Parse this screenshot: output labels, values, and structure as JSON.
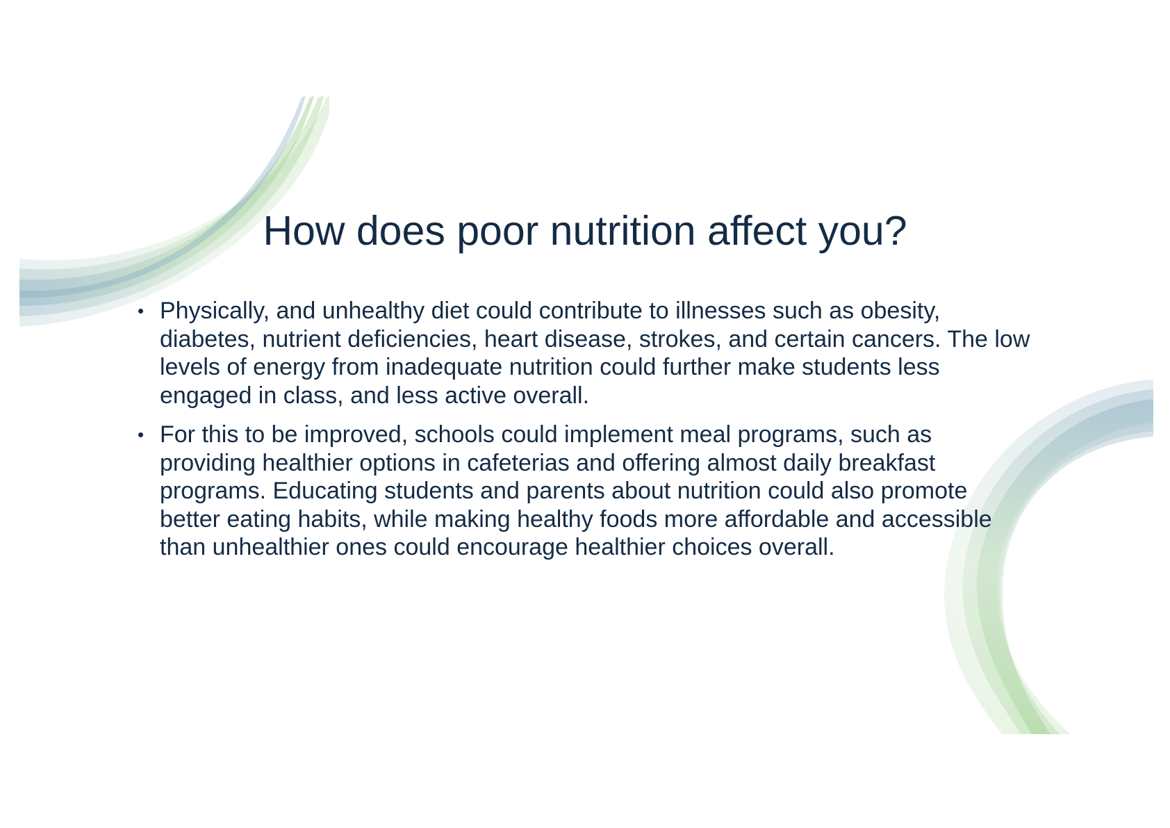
{
  "slide": {
    "title": "How does poor nutrition affect you?",
    "bullet_glyph": "•",
    "bullets": [
      "Physically, and unhealthy diet could contribute to illnesses such as obesity, diabetes, nutrient deficiencies, heart disease, strokes, and certain cancers. The low levels of energy from inadequate nutrition could further make students less engaged in class, and less active overall.",
      "For this to be improved, schools could implement meal programs, such as providing healthier options in cafeterias and offering almost daily breakfast programs. Educating students and parents about nutrition could also promote better eating habits, while making healthy foods more affordable and accessible than unhealthier ones could encourage healthier choices overall."
    ]
  },
  "colors": {
    "text": "#142b45",
    "accent_green": "#8cc97a",
    "accent_blue": "#7fa6bd",
    "background": "#ffffff"
  }
}
